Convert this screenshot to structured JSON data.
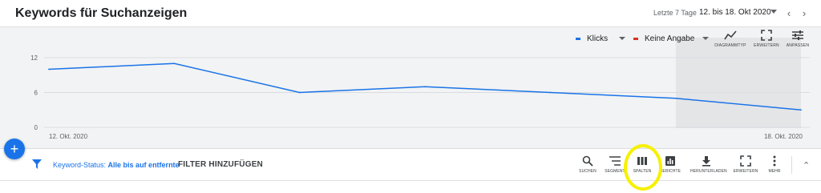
{
  "header": {
    "title": "Keywords für Suchanzeigen",
    "date_hint": "Letzte 7 Tage",
    "date_range": "12. bis 18. Okt 2020",
    "prev_symbol": "‹",
    "next_symbol": "›"
  },
  "chart_controls": {
    "legend": [
      {
        "label": "Klicks",
        "color": "#1a73e8"
      },
      {
        "label": "Keine Angabe",
        "color": "#d93025"
      }
    ],
    "tools": [
      {
        "label": "DIAGRAMMTYP",
        "icon": "chart-type-icon"
      },
      {
        "label": "ERWEITERN",
        "icon": "expand-icon"
      },
      {
        "label": "ANPASSEN",
        "icon": "adjust-icon"
      }
    ]
  },
  "chart_data": {
    "type": "line",
    "x": [
      "12. Okt. 2020",
      "13. Okt. 2020",
      "14. Okt. 2020",
      "15. Okt. 2020",
      "16. Okt. 2020",
      "17. Okt. 2020",
      "18. Okt. 2020"
    ],
    "x_tick_labels": [
      "12. Okt. 2020",
      "18. Okt. 2020"
    ],
    "series": [
      {
        "name": "Klicks",
        "values": [
          10,
          11,
          6,
          7,
          6,
          5,
          3
        ]
      }
    ],
    "yticks": [
      0,
      6,
      12
    ],
    "ylim": [
      0,
      12
    ],
    "grid": true,
    "highlight_last_period": true
  },
  "filter_bar": {
    "status_prefix": "Keyword-Status:",
    "status_value": "Alle bis auf entfernte",
    "add_filter": "FILTER HINZUFÜGEN",
    "tools": [
      {
        "label": "SUCHEN",
        "icon": "search-icon"
      },
      {
        "label": "SEGMENT",
        "icon": "segment-icon"
      },
      {
        "label": "SPALTEN",
        "icon": "columns-icon"
      },
      {
        "label": "BERICHTE",
        "icon": "reports-icon"
      },
      {
        "label": "HERUNTERLADEN",
        "icon": "download-icon"
      },
      {
        "label": "ERWEITERN",
        "icon": "expand-icon"
      },
      {
        "label": "MEHR",
        "icon": "more-icon"
      }
    ],
    "collapse_symbol": "⌃"
  },
  "fab": {
    "symbol": "+"
  },
  "colors": {
    "accent": "#1a73e8",
    "highlight": "#f6f100",
    "error": "#d93025"
  }
}
